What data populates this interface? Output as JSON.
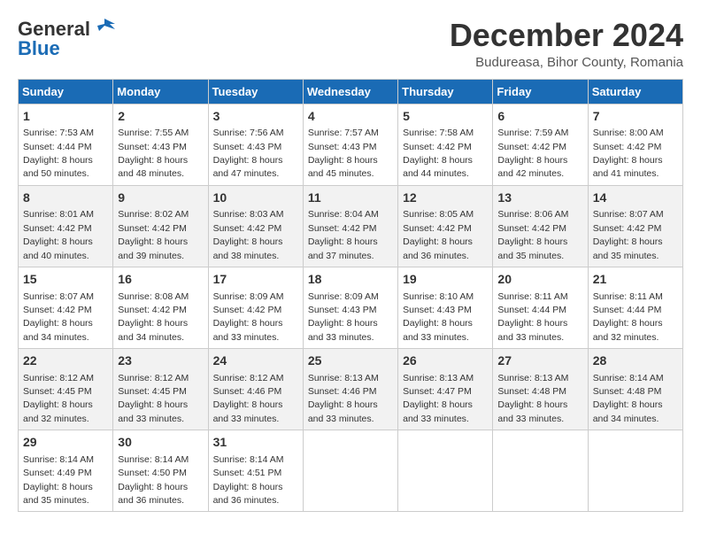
{
  "logo": {
    "general": "General",
    "blue": "Blue"
  },
  "title": "December 2024",
  "location": "Budureasa, Bihor County, Romania",
  "days_of_week": [
    "Sunday",
    "Monday",
    "Tuesday",
    "Wednesday",
    "Thursday",
    "Friday",
    "Saturday"
  ],
  "weeks": [
    [
      {
        "day": "1",
        "sunrise": "7:53 AM",
        "sunset": "4:44 PM",
        "daylight": "8 hours and 50 minutes."
      },
      {
        "day": "2",
        "sunrise": "7:55 AM",
        "sunset": "4:43 PM",
        "daylight": "8 hours and 48 minutes."
      },
      {
        "day": "3",
        "sunrise": "7:56 AM",
        "sunset": "4:43 PM",
        "daylight": "8 hours and 47 minutes."
      },
      {
        "day": "4",
        "sunrise": "7:57 AM",
        "sunset": "4:43 PM",
        "daylight": "8 hours and 45 minutes."
      },
      {
        "day": "5",
        "sunrise": "7:58 AM",
        "sunset": "4:42 PM",
        "daylight": "8 hours and 44 minutes."
      },
      {
        "day": "6",
        "sunrise": "7:59 AM",
        "sunset": "4:42 PM",
        "daylight": "8 hours and 42 minutes."
      },
      {
        "day": "7",
        "sunrise": "8:00 AM",
        "sunset": "4:42 PM",
        "daylight": "8 hours and 41 minutes."
      }
    ],
    [
      {
        "day": "8",
        "sunrise": "8:01 AM",
        "sunset": "4:42 PM",
        "daylight": "8 hours and 40 minutes."
      },
      {
        "day": "9",
        "sunrise": "8:02 AM",
        "sunset": "4:42 PM",
        "daylight": "8 hours and 39 minutes."
      },
      {
        "day": "10",
        "sunrise": "8:03 AM",
        "sunset": "4:42 PM",
        "daylight": "8 hours and 38 minutes."
      },
      {
        "day": "11",
        "sunrise": "8:04 AM",
        "sunset": "4:42 PM",
        "daylight": "8 hours and 37 minutes."
      },
      {
        "day": "12",
        "sunrise": "8:05 AM",
        "sunset": "4:42 PM",
        "daylight": "8 hours and 36 minutes."
      },
      {
        "day": "13",
        "sunrise": "8:06 AM",
        "sunset": "4:42 PM",
        "daylight": "8 hours and 35 minutes."
      },
      {
        "day": "14",
        "sunrise": "8:07 AM",
        "sunset": "4:42 PM",
        "daylight": "8 hours and 35 minutes."
      }
    ],
    [
      {
        "day": "15",
        "sunrise": "8:07 AM",
        "sunset": "4:42 PM",
        "daylight": "8 hours and 34 minutes."
      },
      {
        "day": "16",
        "sunrise": "8:08 AM",
        "sunset": "4:42 PM",
        "daylight": "8 hours and 34 minutes."
      },
      {
        "day": "17",
        "sunrise": "8:09 AM",
        "sunset": "4:42 PM",
        "daylight": "8 hours and 33 minutes."
      },
      {
        "day": "18",
        "sunrise": "8:09 AM",
        "sunset": "4:43 PM",
        "daylight": "8 hours and 33 minutes."
      },
      {
        "day": "19",
        "sunrise": "8:10 AM",
        "sunset": "4:43 PM",
        "daylight": "8 hours and 33 minutes."
      },
      {
        "day": "20",
        "sunrise": "8:11 AM",
        "sunset": "4:44 PM",
        "daylight": "8 hours and 33 minutes."
      },
      {
        "day": "21",
        "sunrise": "8:11 AM",
        "sunset": "4:44 PM",
        "daylight": "8 hours and 32 minutes."
      }
    ],
    [
      {
        "day": "22",
        "sunrise": "8:12 AM",
        "sunset": "4:45 PM",
        "daylight": "8 hours and 32 minutes."
      },
      {
        "day": "23",
        "sunrise": "8:12 AM",
        "sunset": "4:45 PM",
        "daylight": "8 hours and 33 minutes."
      },
      {
        "day": "24",
        "sunrise": "8:12 AM",
        "sunset": "4:46 PM",
        "daylight": "8 hours and 33 minutes."
      },
      {
        "day": "25",
        "sunrise": "8:13 AM",
        "sunset": "4:46 PM",
        "daylight": "8 hours and 33 minutes."
      },
      {
        "day": "26",
        "sunrise": "8:13 AM",
        "sunset": "4:47 PM",
        "daylight": "8 hours and 33 minutes."
      },
      {
        "day": "27",
        "sunrise": "8:13 AM",
        "sunset": "4:48 PM",
        "daylight": "8 hours and 33 minutes."
      },
      {
        "day": "28",
        "sunrise": "8:14 AM",
        "sunset": "4:48 PM",
        "daylight": "8 hours and 34 minutes."
      }
    ],
    [
      {
        "day": "29",
        "sunrise": "8:14 AM",
        "sunset": "4:49 PM",
        "daylight": "8 hours and 35 minutes."
      },
      {
        "day": "30",
        "sunrise": "8:14 AM",
        "sunset": "4:50 PM",
        "daylight": "8 hours and 36 minutes."
      },
      {
        "day": "31",
        "sunrise": "8:14 AM",
        "sunset": "4:51 PM",
        "daylight": "8 hours and 36 minutes."
      },
      null,
      null,
      null,
      null
    ]
  ]
}
